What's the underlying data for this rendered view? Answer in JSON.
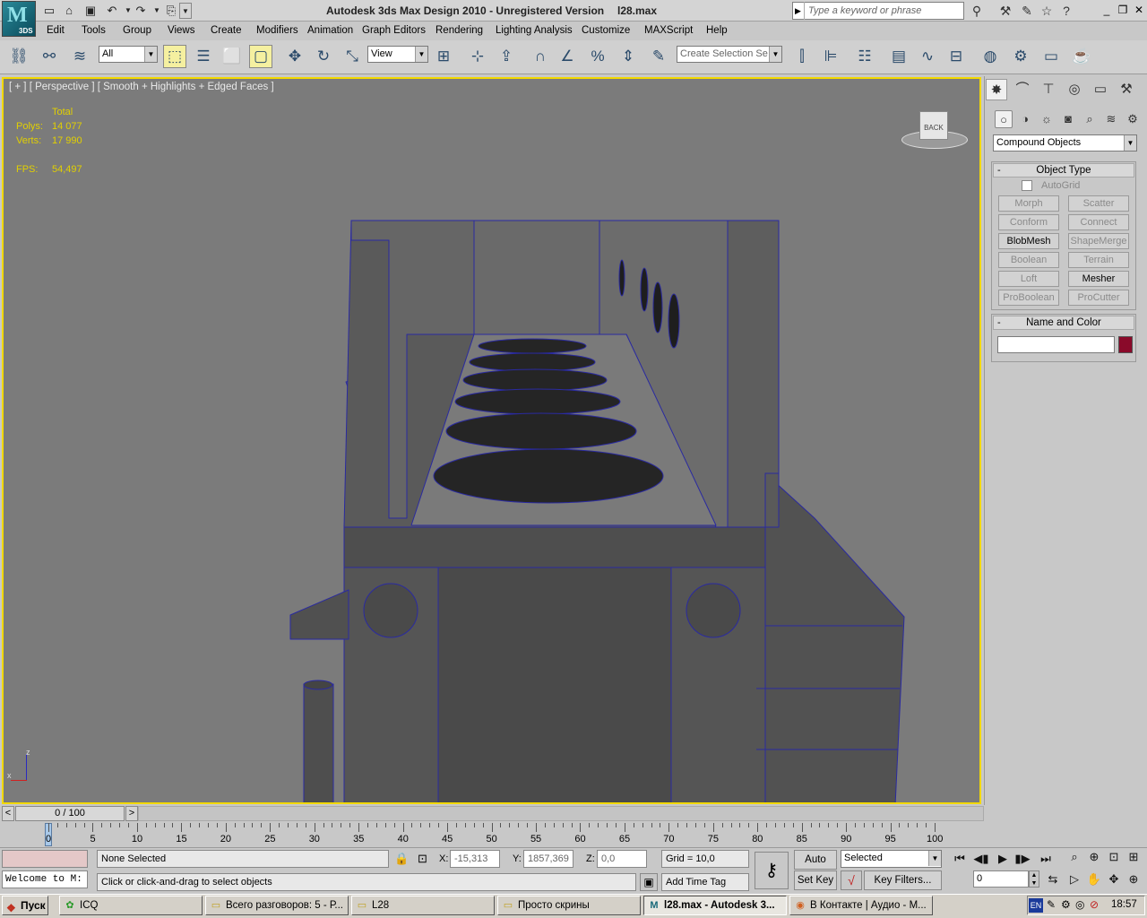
{
  "titlebar": {
    "app_title": "Autodesk 3ds Max Design 2010  - Unregistered Version",
    "file_name": "l28.max",
    "logo_text": "3DS",
    "search_placeholder": "Type a keyword or phrase"
  },
  "menu": [
    "Edit",
    "Tools",
    "Group",
    "Views",
    "Create",
    "Modifiers",
    "Animation",
    "Graph Editors",
    "Rendering",
    "Lighting Analysis",
    "Customize",
    "MAXScript",
    "Help"
  ],
  "toolbar": {
    "selection_filter": "All",
    "ref_coord": "View",
    "named_selection": "Create Selection Se"
  },
  "viewport": {
    "label": "[ + ] [ Perspective ] [ Smooth + Highlights + Edged Faces ]",
    "stats_header": "Total",
    "polys_label": "Polys:",
    "polys_value": "14 077",
    "verts_label": "Verts:",
    "verts_value": "17 990",
    "fps_label": "FPS:",
    "fps_value": "54,497",
    "viewcube_label": "BACK",
    "axis_z": "z",
    "axis_x": "x"
  },
  "command_panel": {
    "dropdown_value": "Compound Objects",
    "object_type_title": "Object Type",
    "autogrid_label": "AutoGrid",
    "buttons": [
      {
        "label": "Morph",
        "enabled": false
      },
      {
        "label": "Scatter",
        "enabled": false
      },
      {
        "label": "Conform",
        "enabled": false
      },
      {
        "label": "Connect",
        "enabled": false
      },
      {
        "label": "BlobMesh",
        "enabled": true
      },
      {
        "label": "ShapeMerge",
        "enabled": false
      },
      {
        "label": "Boolean",
        "enabled": false
      },
      {
        "label": "Terrain",
        "enabled": false
      },
      {
        "label": "Loft",
        "enabled": false
      },
      {
        "label": "Mesher",
        "enabled": true
      },
      {
        "label": "ProBoolean",
        "enabled": false
      },
      {
        "label": "ProCutter",
        "enabled": false
      }
    ],
    "name_color_title": "Name and Color",
    "name_value": "",
    "object_color": "#8a0a2a"
  },
  "timeline": {
    "frame_display": "0 / 100",
    "prev": "<",
    "next": ">",
    "ticks": [
      "0",
      "5",
      "10",
      "15",
      "20",
      "25",
      "30",
      "35",
      "40",
      "45",
      "50",
      "55",
      "60",
      "65",
      "70",
      "75",
      "80",
      "85",
      "90",
      "95",
      "100"
    ]
  },
  "status": {
    "listener_text": "Welcome to M:",
    "selection_text": "None Selected",
    "prompt_text": "Click or click-and-drag to select objects",
    "x_label": "X:",
    "x_value": "-15,313",
    "y_label": "Y:",
    "y_value": "1857,369",
    "z_label": "Z:",
    "z_value": "0,0",
    "grid_text": "Grid = 10,0",
    "add_time_tag": "Add Time Tag",
    "auto_key": "Auto Key",
    "set_key": "Set Key",
    "key_mode": "Selected",
    "key_filters": "Key Filters...",
    "current_frame": "0"
  },
  "taskbar": {
    "start": "Пуск",
    "tasks": [
      {
        "label": "ICQ",
        "active": false
      },
      {
        "label": "Всего разговоров: 5 - Р...",
        "active": false
      },
      {
        "label": "L28",
        "active": false
      },
      {
        "label": "Просто скрины",
        "active": false
      },
      {
        "label": "l28.max - Autodesk 3...",
        "active": true
      },
      {
        "label": "В Контакте | Аудио - М...",
        "active": false
      }
    ],
    "lang": "EN",
    "clock": "18:57"
  },
  "colors": {
    "viewport_bg": "#7b7b7b",
    "viewport_border": "#f2d800",
    "stats_text": "#e2d000",
    "wire": "#2a2aa0"
  }
}
